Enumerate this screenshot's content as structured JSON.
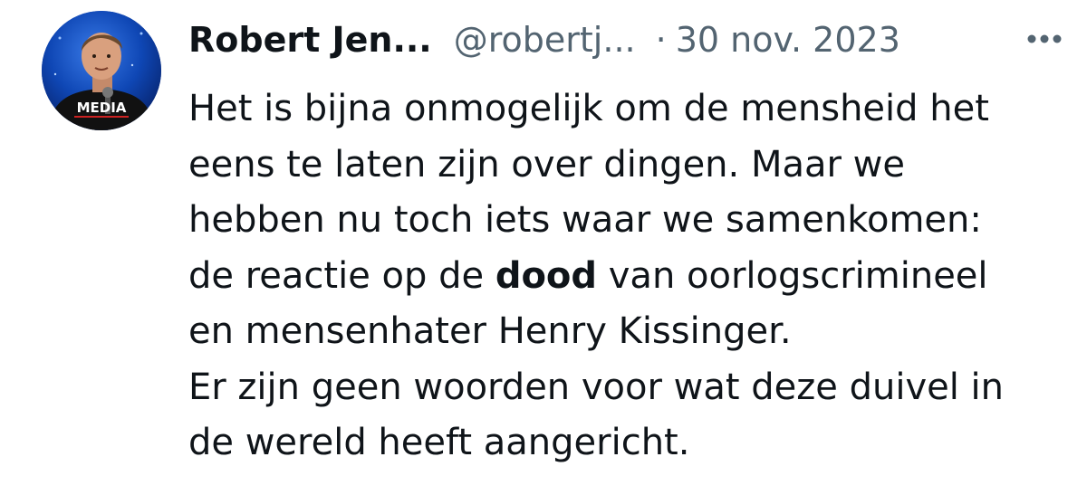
{
  "tweet": {
    "author_name": "Robert Jen...",
    "author_handle": "@robertj...",
    "separator": "·",
    "date": "30 nov. 2023",
    "avatar_text": "MEDIA",
    "more_icon": "more-horizontal-icon",
    "body": {
      "line1": "Het is bijna onmogelijk om de mensheid het",
      "line2": "eens te laten zijn over dingen. Maar we",
      "line3": "hebben nu toch iets waar we samenkomen:",
      "line4_before": "de reactie op de ",
      "line4_bold": "dood",
      "line4_after": " van oorlogscrimineel",
      "line5": "en mensenhater Henry Kissinger.",
      "line6": "Er zijn geen woorden voor wat deze duivel in",
      "line7": "de wereld heeft aangericht."
    },
    "colors": {
      "text_primary": "#0f1419",
      "text_secondary": "#536471",
      "avatar_bg": "#0c3a9e"
    }
  }
}
